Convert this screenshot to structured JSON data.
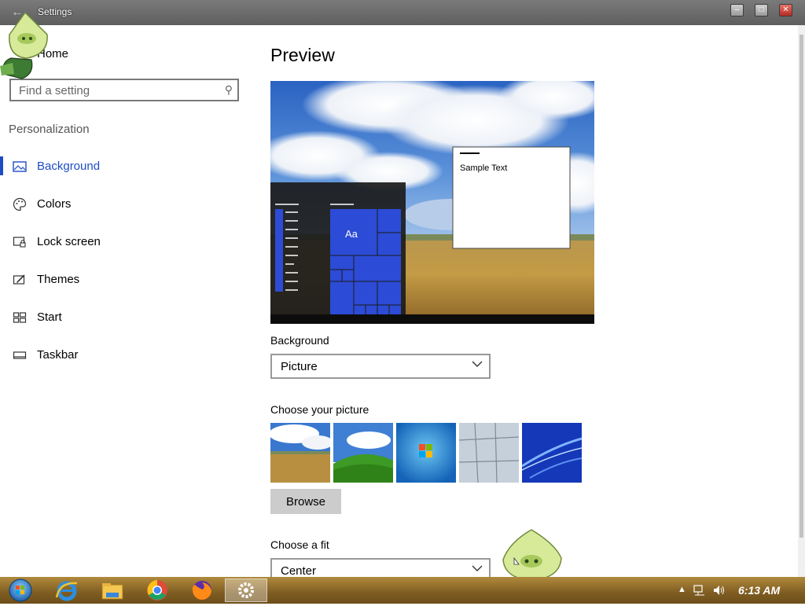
{
  "window": {
    "title": "Settings"
  },
  "sidebar": {
    "home_label": "Home",
    "search_placeholder": "Find a setting",
    "section_label": "Personalization",
    "items": [
      {
        "label": "Background",
        "icon": "picture-icon",
        "active": true
      },
      {
        "label": "Colors",
        "icon": "palette-icon",
        "active": false
      },
      {
        "label": "Lock screen",
        "icon": "lock-screen-icon",
        "active": false
      },
      {
        "label": "Themes",
        "icon": "themes-icon",
        "active": false
      },
      {
        "label": "Start",
        "icon": "start-icon",
        "active": false
      },
      {
        "label": "Taskbar",
        "icon": "taskbar-icon",
        "active": false
      }
    ]
  },
  "main": {
    "heading": "Preview",
    "preview": {
      "sample_text": "Sample Text",
      "tile_text": "Aa"
    },
    "background_label": "Background",
    "background_value": "Picture",
    "choose_picture_label": "Choose your picture",
    "pictures": [
      "wheat-field-sky",
      "green-hills-bliss",
      "windows-7-logo",
      "glass-building",
      "blue-light-streaks"
    ],
    "browse_label": "Browse",
    "choose_fit_label": "Choose a fit",
    "fit_value": "Center"
  },
  "taskbar": {
    "apps": [
      "start-orb",
      "internet-explorer",
      "file-explorer",
      "chrome",
      "firefox",
      "settings"
    ],
    "clock": "6:13 AM"
  },
  "colors": {
    "accent": "#1e4cc4",
    "titlebar": "#6a6a6a",
    "taskbar": "#8a6526"
  }
}
